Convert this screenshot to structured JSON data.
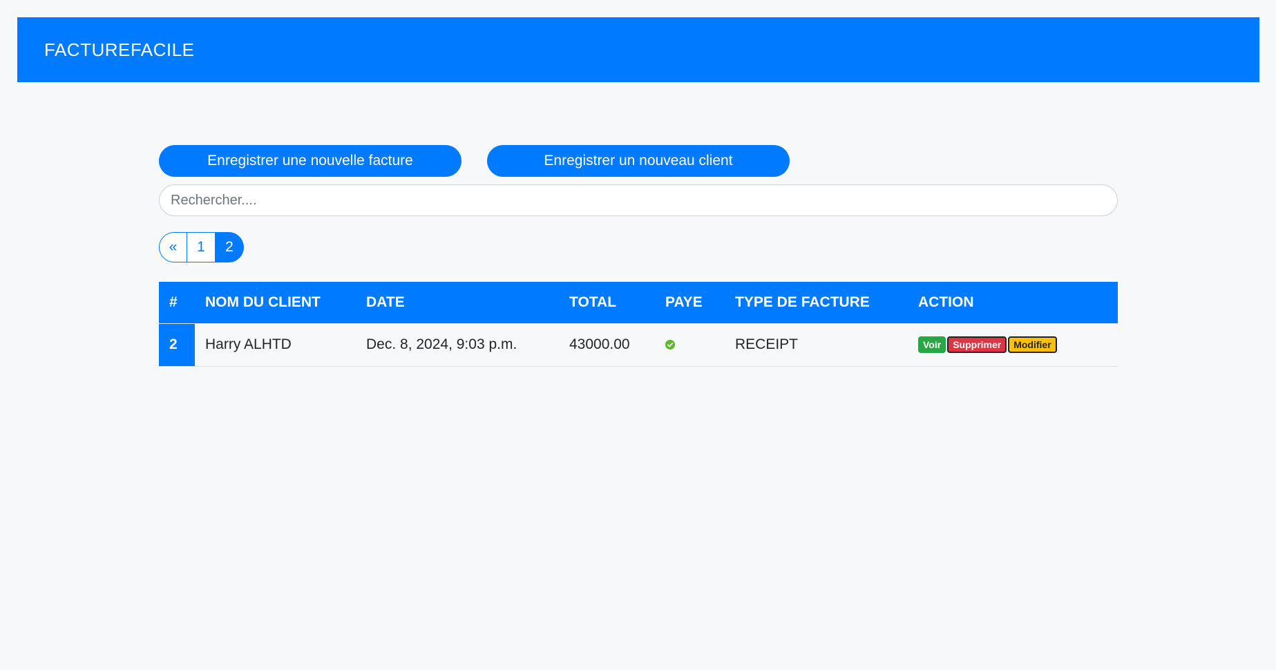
{
  "navbar": {
    "brand": "FACTUREFACILE"
  },
  "actions": {
    "new_invoice_label": "Enregistrer une nouvelle facture",
    "new_client_label": "Enregistrer un nouveau client"
  },
  "search": {
    "placeholder": "Rechercher....",
    "value": ""
  },
  "pagination": {
    "prev_label": "«",
    "pages": [
      "1",
      "2"
    ],
    "current": "2"
  },
  "table": {
    "headers": [
      "#",
      "NOM DU CLIENT",
      "DATE",
      "TOTAL",
      "PAYE",
      "TYPE DE FACTURE",
      "ACTION"
    ],
    "rows": [
      {
        "id": "2",
        "client": "Harry ALHTD",
        "date": "Dec. 8, 2024, 9:03 p.m.",
        "total": "43000.00",
        "paid": true,
        "paid_icon": "check-circle-icon",
        "type": "RECEIPT",
        "actions": {
          "view": "Voir",
          "delete": "Supprimer",
          "edit": "Modifier"
        }
      }
    ]
  },
  "colors": {
    "primary": "#007bff",
    "success": "#28a745",
    "danger": "#dc3545",
    "warning": "#ffc107",
    "background": "#f7f8fa"
  }
}
